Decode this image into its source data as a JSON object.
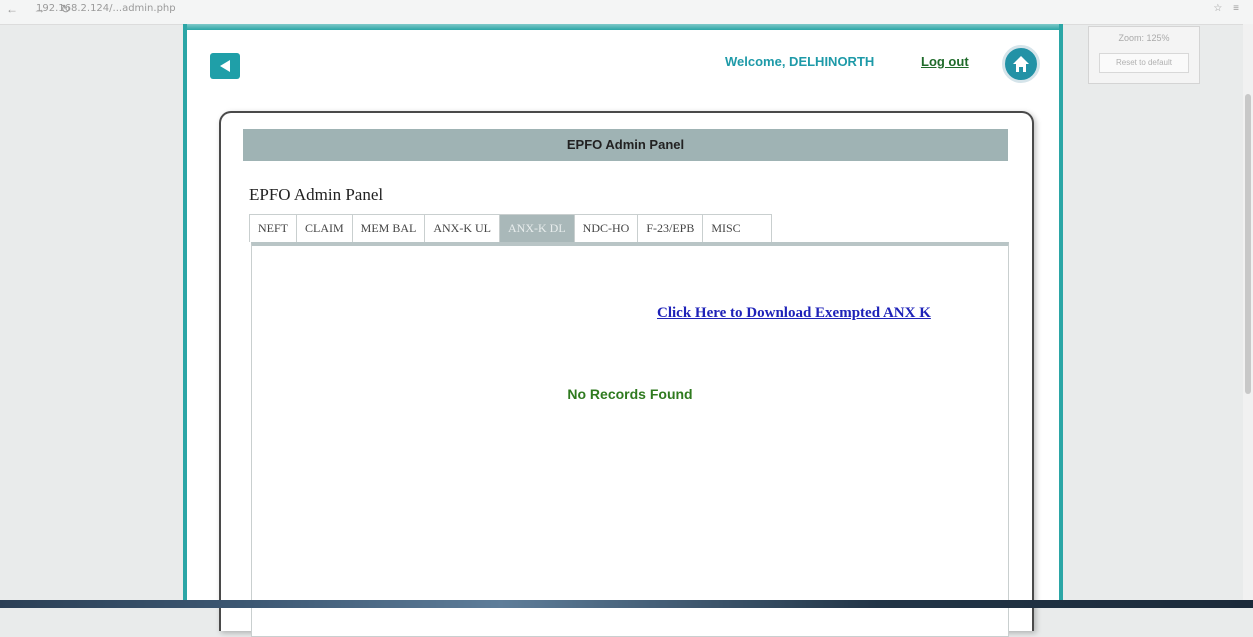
{
  "browser": {
    "url": "192.168.2.124/...admin.php",
    "zoom_label": "Zoom: 125%",
    "reset_label": "Reset to default"
  },
  "header": {
    "welcome": "Welcome, DELHINORTH",
    "logout": "Log out"
  },
  "panel": {
    "title": "EPFO Admin Panel",
    "subtitle": "EPFO Admin Panel"
  },
  "tabs": [
    {
      "label": "NEFT",
      "active": false
    },
    {
      "label": "CLAIM",
      "active": false
    },
    {
      "label": "MEM BAL",
      "active": false
    },
    {
      "label": "ANX-K UL",
      "active": false
    },
    {
      "label": "ANX-K DL",
      "active": true
    },
    {
      "label": "NDC-HO",
      "active": false
    },
    {
      "label": "F-23/EPB",
      "active": false
    },
    {
      "label": "MISC",
      "active": false
    }
  ],
  "content": {
    "download_link": "Click Here to Download Exempted ANX K",
    "empty_message": "No Records Found"
  },
  "colors": {
    "accent": "#2ba6a6",
    "header_bar": "#9fb3b4",
    "link": "#1e22b8",
    "success_text": "#2f7a1f"
  }
}
